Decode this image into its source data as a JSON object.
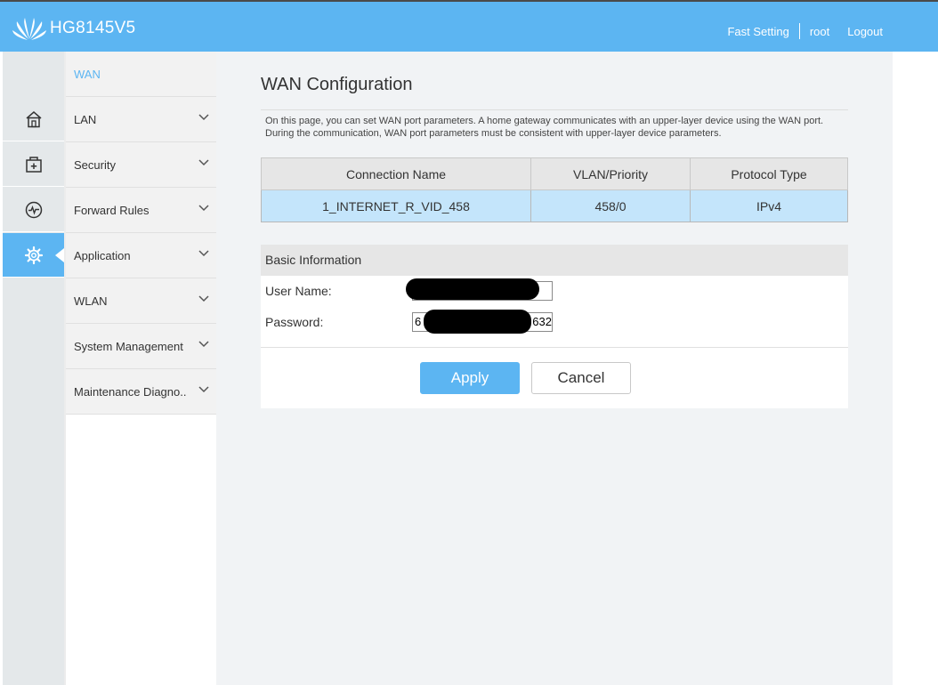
{
  "header": {
    "model": "HG8145V5",
    "links": [
      "Fast Setting",
      "root",
      "Logout"
    ]
  },
  "sidebar_icons": [
    "home-icon",
    "add-box-icon",
    "pulse-icon",
    "gear-icon"
  ],
  "menu": {
    "items": [
      {
        "label": "WAN"
      },
      {
        "label": "LAN"
      },
      {
        "label": "Security"
      },
      {
        "label": "Forward Rules"
      },
      {
        "label": "Application"
      },
      {
        "label": "WLAN"
      },
      {
        "label": "System Management"
      },
      {
        "label": "Maintenance Diagno.."
      }
    ]
  },
  "page": {
    "title": "WAN Configuration",
    "description": "On this page, you can set WAN port parameters. A home gateway communicates with an upper-layer device using the WAN port. During the communication, WAN port parameters must be consistent with upper-layer device parameters."
  },
  "table": {
    "headers": [
      "Connection Name",
      "VLAN/Priority",
      "Protocol Type"
    ],
    "rows": [
      [
        "1_INTERNET_R_VID_458",
        "458/0",
        "IPv4"
      ]
    ]
  },
  "basic": {
    "title": "Basic Information",
    "username_label": "User Name:",
    "password_label": "Password:",
    "password_value_prefix": "6",
    "password_value_suffix": "632",
    "apply_label": "Apply",
    "cancel_label": "Cancel"
  },
  "colors": {
    "accent": "#5cb5f2",
    "row_highlight": "#c4e5fb"
  }
}
